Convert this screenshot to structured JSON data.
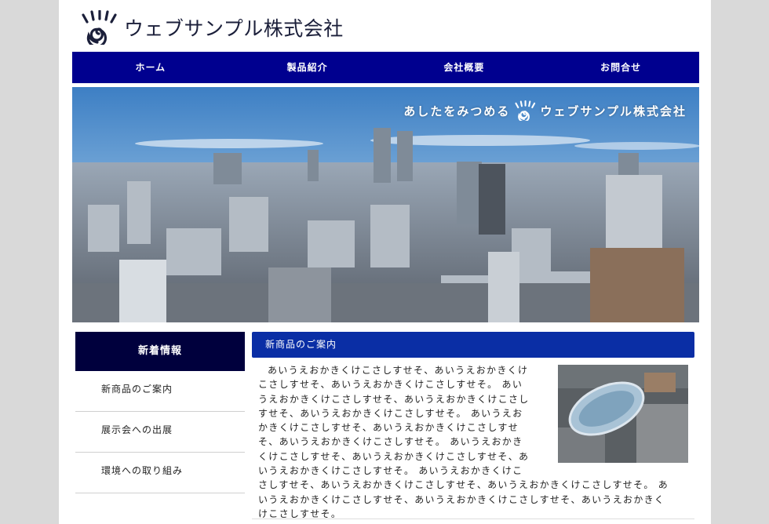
{
  "header": {
    "company_name": "ウェブサンプル株式会社",
    "logo_icon": "eye-swirl-logo-icon"
  },
  "nav": {
    "items": [
      {
        "label": "ホーム"
      },
      {
        "label": "製品紹介"
      },
      {
        "label": "会社概要"
      },
      {
        "label": "お問合せ"
      }
    ]
  },
  "hero": {
    "tagline_prefix": "あしたをみつめる",
    "tagline_company": "ウェブサンプル株式会社",
    "image": "city-skyline-photo"
  },
  "sidebar": {
    "heading": "新着情報",
    "items": [
      {
        "label": "新商品のご案内"
      },
      {
        "label": "展示会への出展"
      },
      {
        "label": "環境への取り組み"
      }
    ]
  },
  "main": {
    "heading": "新商品のご案内",
    "body": "あいうえおかきくけこさしすせそ、あいうえおかきくけこさしすせそ、あいうえおかきくけこさしすせそ。 あいうえおかきくけこさしすせそ、あいうえおかきくけこさしすせそ、あいうえおかきくけこさしすせそ。 あいうえおかきくけこさしすせそ、あいうえおかきくけこさしすせそ、あいうえおかきくけこさしすせそ。 あいうえおかきくけこさしすせそ、あいうえおかきくけこさしすせそ、あいうえおかきくけこさしすせそ。 あいうえおかきくけこさしすせそ、あいうえおかきくけこさしすせそ、あいうえおかきくけこさしすせそ。 あいうえおかきくけこさしすせそ、あいうえおかきくけこさしすせそ、あいうえおかきくけこさしすせそ。",
    "photo": "oval-glass-roof-building-photo"
  },
  "colors": {
    "nav_bg": "#00008f",
    "sidebar_head_bg": "#00003d",
    "main_head_bg": "#0a2ea5",
    "page_bg": "#d9d9d9"
  }
}
